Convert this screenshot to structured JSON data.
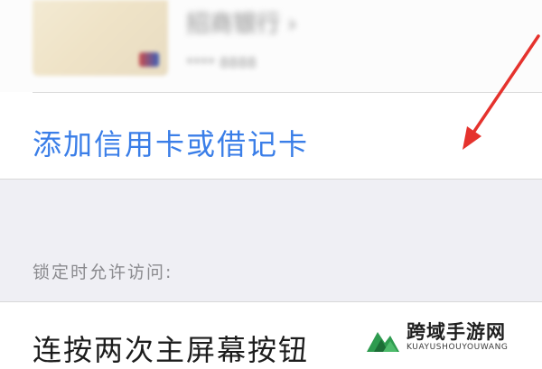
{
  "card": {
    "name": "招商银行 ›",
    "number": "**** 8888"
  },
  "add_card": {
    "label": "添加信用卡或借记卡"
  },
  "section": {
    "header": "锁定时允许访问:"
  },
  "home_button_row": {
    "label": "连按两次主屏幕按钮"
  },
  "annotation": {
    "arrow_color": "#e5322d"
  },
  "watermark": {
    "title": "跨域手游网",
    "subtitle": "KUAYUSHOUYOUWANG"
  },
  "colors": {
    "link": "#3a7ee8",
    "group_background": "#efeff4",
    "section_text": "#8a8a8e"
  }
}
